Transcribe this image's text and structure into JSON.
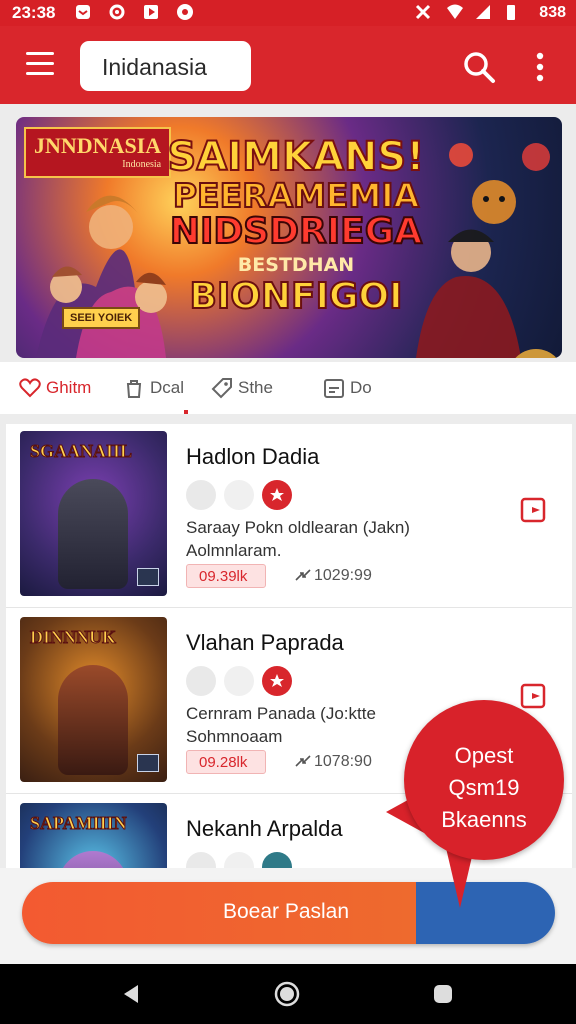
{
  "status": {
    "time": "23:38",
    "right_text": "838"
  },
  "appbar": {
    "search_value": "Inidanasia",
    "menu_icon": "menu-icon",
    "search_icon": "search-icon",
    "more_icon": "more-vert-icon"
  },
  "banner": {
    "tag": "JNNDNASIA",
    "tag_sub": "Indonesia",
    "line1": "SAIMKANS!",
    "line2": "PEERAMEMIA",
    "line3": "NIDSDRIEGA",
    "line4": "BESTDHAN",
    "line5": "BIONFIGOI",
    "plaque": "SEEI YOIEK"
  },
  "categories": [
    {
      "label": "Ghitm",
      "icon": "heart-icon",
      "active": true
    },
    {
      "label": "Dcal",
      "icon": "bag-icon",
      "active": false
    },
    {
      "label": "Sthe",
      "icon": "tag-icon",
      "active": false
    },
    {
      "label": "Do",
      "icon": "calendar-icon",
      "active": false
    }
  ],
  "games": [
    {
      "title": "Hadlon Dadia",
      "thumb_title": "SGAANAIIL",
      "desc_line1": "Saraay  Pokn oldlearan (Jakn)",
      "desc_line2": "Aolmnlaram.",
      "price": "09.39lk",
      "count": "1029:99",
      "colors": [
        "#3b2a6b",
        "#7a3fb0",
        "#1b1a40"
      ]
    },
    {
      "title": "Vlahan Paprada",
      "thumb_title": "DINNNUK",
      "desc_line1": "Cernram Panada (Jo:ktte",
      "desc_line2": "Sohmnoaam",
      "price": "09.28lk",
      "count": "1078:90",
      "colors": [
        "#6b3b18",
        "#e08a2a",
        "#3a1f12"
      ]
    },
    {
      "title": "Nekanh Arpalda",
      "thumb_title": "SAPAMIIIN",
      "desc_line1": "",
      "desc_line2": "",
      "price": "",
      "count": "",
      "colors": [
        "#23407a",
        "#5ac3e8",
        "#15233f"
      ]
    }
  ],
  "cta": {
    "label": "Boear Paslan"
  },
  "bubble": {
    "line1": "Opest",
    "line2": "Qsm19",
    "line3": "Bkaenns"
  }
}
